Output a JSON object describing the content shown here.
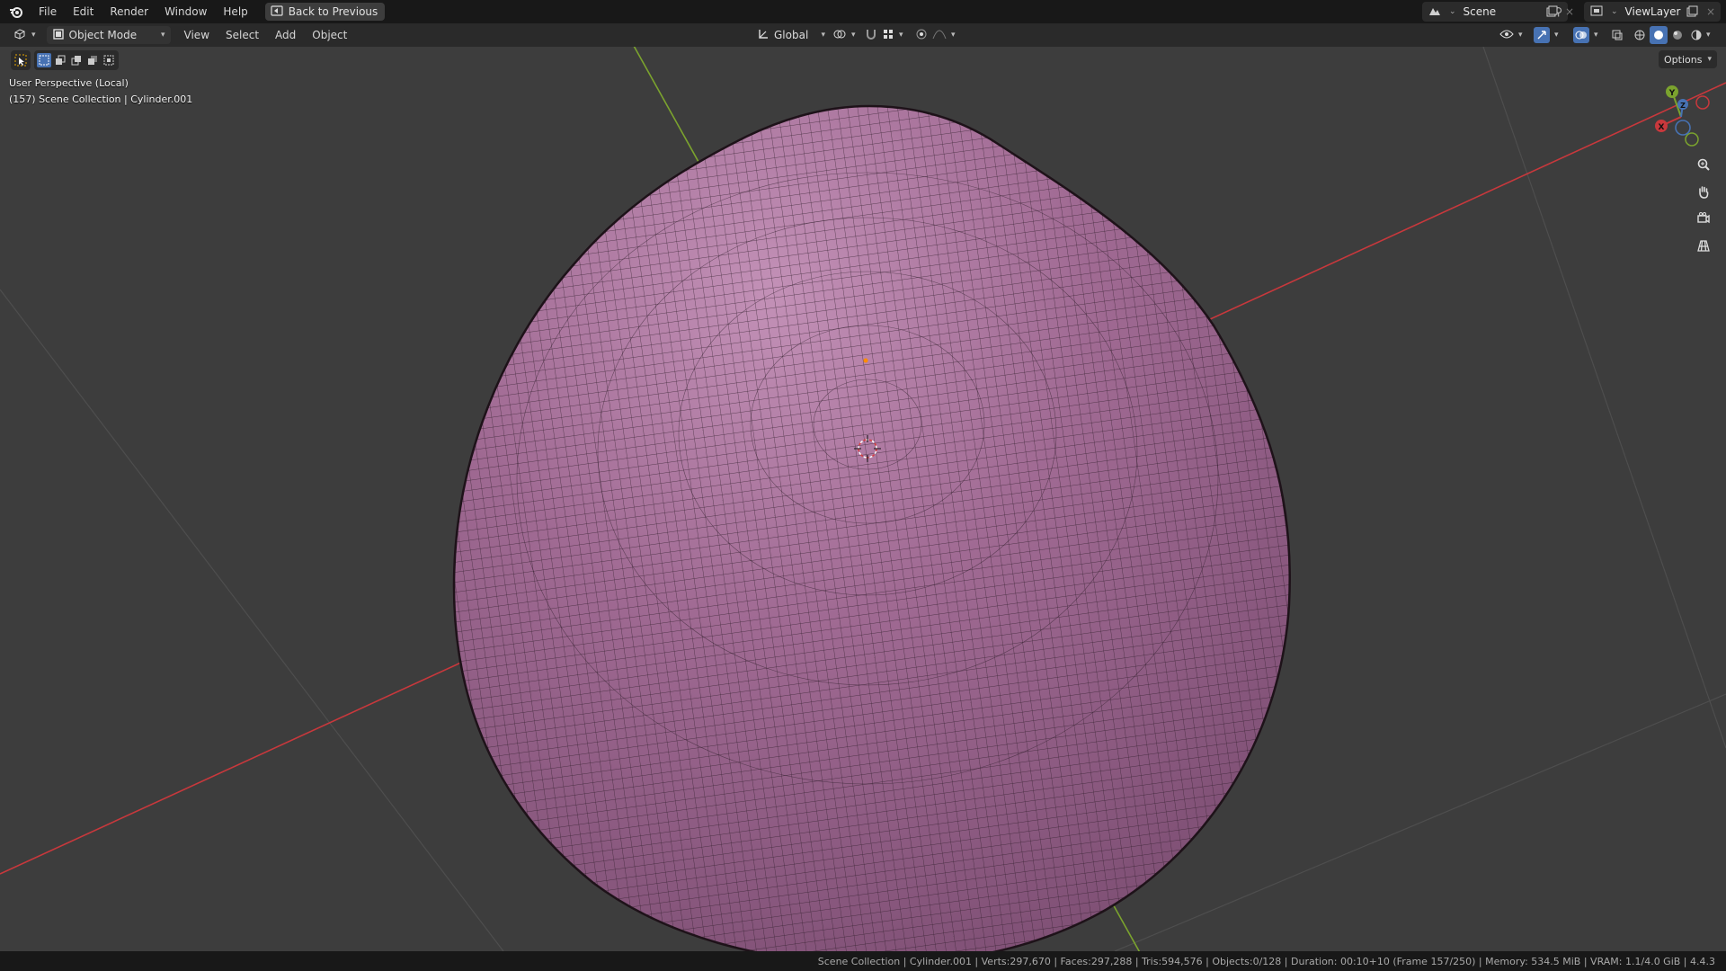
{
  "menubar": {
    "items": [
      "File",
      "Edit",
      "Render",
      "Window",
      "Help"
    ],
    "back_button": "Back to Previous",
    "scene": "Scene",
    "view_layer": "ViewLayer"
  },
  "header": {
    "mode": "Object Mode",
    "menus": [
      "View",
      "Select",
      "Add",
      "Object"
    ],
    "orientation": "Global"
  },
  "viewport": {
    "perspective": "User Perspective (Local)",
    "collection_line": "(157) Scene Collection | Cylinder.001",
    "options_label": "Options",
    "gizmo": {
      "y": "Y",
      "z": "Z",
      "x": "X"
    }
  },
  "statusbar": {
    "text": "Scene Collection | Cylinder.001 | Verts:297,670 | Faces:297,288 | Tris:594,576 | Objects:0/128 | Duration: 00:10+10 (Frame 157/250) | Memory: 534.5 MiB | VRAM: 1.1/4.0 GiB | 4.4.3"
  },
  "colors": {
    "mesh": "#a06a93",
    "x_axis": "#c8383c",
    "y_axis": "#7ba32e",
    "accent": "#4772b3"
  },
  "icons": {
    "logo": "blender-logo-icon",
    "editor": "3d-viewport-editor-icon",
    "tools": [
      "select-box-tool-icon",
      "select-mode-icons"
    ],
    "nav": [
      "zoom-icon",
      "hand-pan-icon",
      "camera-view-icon",
      "grid-ortho-icon"
    ]
  }
}
